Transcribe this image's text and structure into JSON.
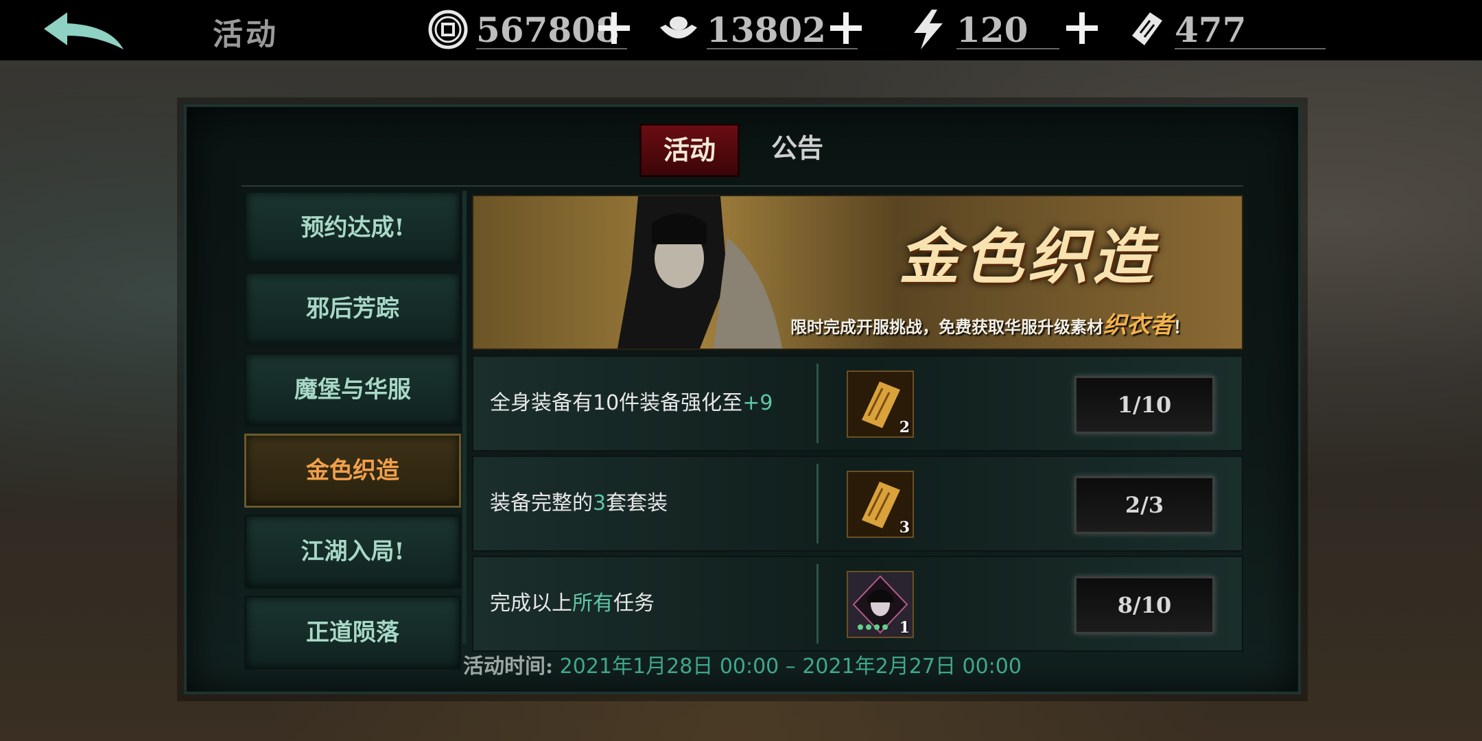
{
  "topbar": {
    "title": "活动",
    "resources": [
      {
        "icon": "copper-coin-icon",
        "value": "567808"
      },
      {
        "icon": "silver-ingot-icon",
        "value": "13802"
      },
      {
        "icon": "lightning-energy-icon",
        "value": "120"
      },
      {
        "icon": "ticket-scroll-icon",
        "value": "477"
      }
    ]
  },
  "tabs": [
    {
      "label": "活动",
      "active": true
    },
    {
      "label": "公告",
      "active": false
    }
  ],
  "sidebar": {
    "items": [
      {
        "label": "预约达成!"
      },
      {
        "label": "邪后芳踪"
      },
      {
        "label": "魔堡与华服"
      },
      {
        "label": "金色织造",
        "active": true
      },
      {
        "label": "江湖入局!"
      },
      {
        "label": "正道陨落"
      }
    ]
  },
  "banner": {
    "title": "金色织造",
    "subtitle": "限时完成开服挑战，免费获取华服升级素材",
    "subtitle_highlight": "织衣者",
    "subtitle_end": "！"
  },
  "tasks": [
    {
      "desc_prefix": "全身装备有10件装备强化至",
      "desc_hl": "+9",
      "desc_suffix": "",
      "reward_count": "2",
      "reward_icon": "gold-talisman-icon",
      "progress": "1/10"
    },
    {
      "desc_prefix": "装备完整的",
      "desc_hl": "3",
      "desc_suffix": "套套装",
      "reward_count": "3",
      "reward_icon": "gold-talisman-icon",
      "progress": "2/3"
    },
    {
      "desc_prefix": "完成以上",
      "desc_hl": "所有",
      "desc_suffix": "任务",
      "reward_count": "1",
      "reward_icon": "character-portrait-icon",
      "progress": "8/10"
    }
  ],
  "footer": {
    "label": "活动时间:",
    "range": "2021年1月28日 00:00 – 2021年2月27日 00:00"
  },
  "colors": {
    "highlight_green": "#5fc7a6",
    "active_orange": "#f2a04a",
    "tab_red": "#6a0d12"
  }
}
